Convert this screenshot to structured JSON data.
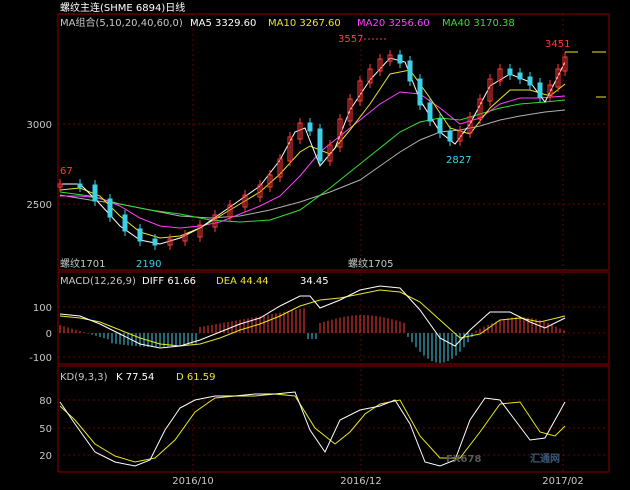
{
  "header": {
    "title": "螺纹主连(SHME 6894)日线",
    "ma_group": "MA组合(5,10,20,40,60,0)",
    "ma5": "MA5 3329.60",
    "ma10": "MA10 3267.60",
    "ma20": "MA20 3256.60",
    "ma40": "MA40 3170.38"
  },
  "price_panel": {
    "y_ticks": [
      "3000",
      "2500"
    ],
    "annotations": {
      "high_3557": "3557",
      "last_3451": "3451",
      "low_2827": "2827",
      "low_2190": "2190",
      "left_67": "67",
      "contract_1701": "螺纹1701",
      "contract_1705": "螺纹1705"
    }
  },
  "macd_panel": {
    "label": "MACD(12,26,9)",
    "diff": "DIFF  61.66",
    "dea": "DEA  44.44",
    "macd": "34.45",
    "y_ticks": [
      "100",
      "0",
      "-100"
    ]
  },
  "kd_panel": {
    "label": "KD(9,3,3)",
    "k": "K   77.54",
    "d": "D   61.59",
    "y_ticks": [
      "80",
      "50",
      "20"
    ]
  },
  "x_axis": {
    "ticks": [
      "2016/10",
      "2016/12",
      "2017/02"
    ]
  },
  "watermark": {
    "brand": "FX678",
    "cn": "汇通网"
  },
  "colors": {
    "up": "#ff3b3b",
    "down": "#3fd0e8",
    "ma5": "#ffffff",
    "ma10": "#e8e820",
    "ma20": "#ff40ff",
    "ma40": "#30e030",
    "ma60": "#b0b0b0",
    "grid": "#8b0000"
  },
  "chart_data": {
    "type": "candlestick",
    "price_ylim": [
      2080,
      3660
    ],
    "macd_ylim": [
      -150,
      200
    ],
    "kd_ylim": [
      0,
      110
    ],
    "candles": [],
    "ma_series": [],
    "macd_series": {},
    "kd_series": {}
  }
}
